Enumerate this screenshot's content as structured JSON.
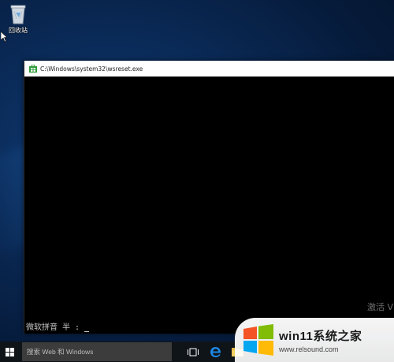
{
  "desktop": {
    "recycle_bin": {
      "label": "回收站",
      "icon": "recycle-bin-icon"
    }
  },
  "window": {
    "title": "C:\\Windows\\system32\\wsreset.exe",
    "icon": "store-app-icon",
    "console": {
      "ime_status": "微软拼音 半 :",
      "activation_watermark": "激活 V"
    }
  },
  "taskbar": {
    "search_placeholder": "搜索 Web 和 Windows",
    "buttons": [
      {
        "name": "start-button",
        "icon": "windows-logo-icon"
      },
      {
        "name": "task-view-button",
        "icon": "task-view-icon"
      },
      {
        "name": "edge-button",
        "icon": "edge-icon"
      },
      {
        "name": "file-explorer-button",
        "icon": "folder-icon"
      }
    ]
  },
  "watermark": {
    "title": "win11系统之家",
    "url": "www.relsound.com"
  },
  "colors": {
    "taskbar": "#0f1419",
    "desktop": "#0a2a57",
    "console": "#000000",
    "titlebar": "#ffffff"
  }
}
